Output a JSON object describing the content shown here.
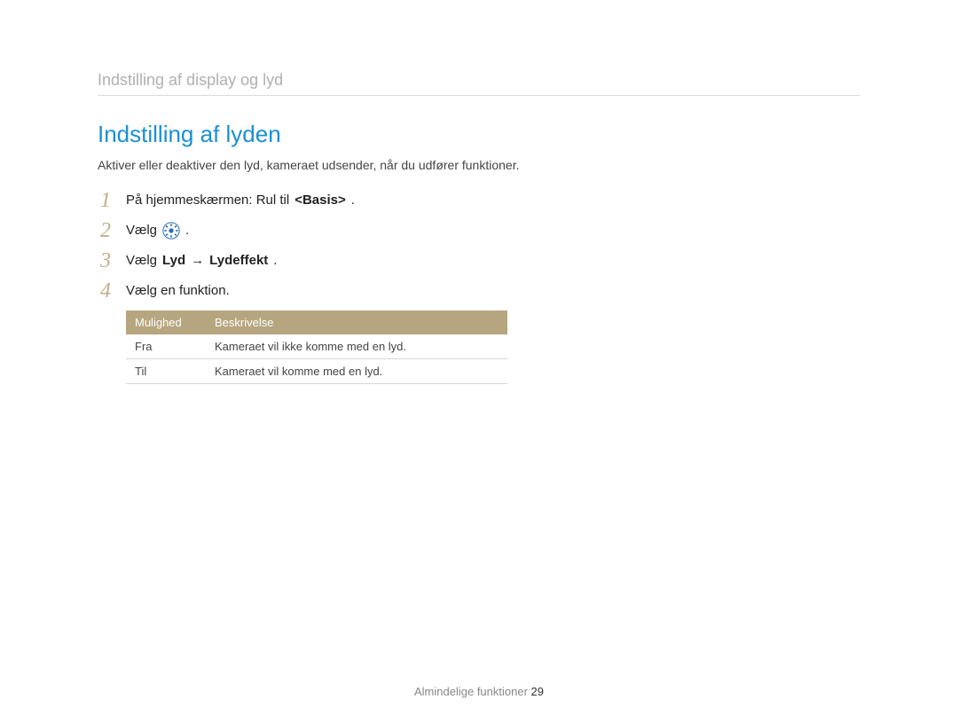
{
  "breadcrumb": "Indstilling af display og lyd",
  "title": "Indstilling af lyden",
  "intro": "Aktiver eller deaktiver den lyd, kameraet udsender, når du udfører funktioner.",
  "steps": {
    "1": {
      "num": "1",
      "pre": "På hjemmeskærmen: Rul til ",
      "bold": "<Basis>",
      "post": "."
    },
    "2": {
      "num": "2",
      "pre": "Vælg ",
      "post": " ."
    },
    "3": {
      "num": "3",
      "pre": "Vælg ",
      "bold": "Lyd",
      "arrow": " → ",
      "bold2": "Lydeffekt",
      "post": "."
    },
    "4": {
      "num": "4",
      "text": "Vælg en funktion."
    }
  },
  "table": {
    "head": {
      "col1": "Mulighed",
      "col2": "Beskrivelse"
    },
    "rows": [
      {
        "opt": "Fra",
        "desc": "Kameraet vil ikke komme med en lyd."
      },
      {
        "opt": "Til",
        "desc": "Kameraet vil komme med en lyd."
      }
    ]
  },
  "footer": {
    "section": "Almindelige funktioner ",
    "page": "29"
  }
}
